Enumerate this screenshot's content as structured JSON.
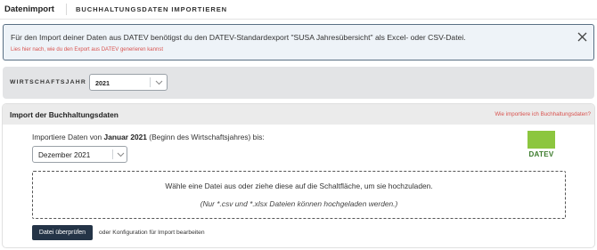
{
  "header": {
    "app_title": "Datenimport",
    "page_title": "BUCHHALTUNGSDATEN IMPORTIEREN"
  },
  "alert": {
    "message": "Für den Import deiner Daten aus DATEV benötigst du den DATEV-Standardexport \"SUSA Jahresübersicht\" als Excel- oder CSV-Datei.",
    "link": "Lies hier nach, wie du den Export aus DATEV generieren kannst",
    "link_color": "#d9534f",
    "close_icon": "close-icon"
  },
  "fiscal_year": {
    "label": "WIRTSCHAFTSJAHR",
    "selected": "2021",
    "icon": "chevron-down-icon"
  },
  "import_card": {
    "title": "Import der Buchhaltungsdaten",
    "help_link": "Wie importiere ich Buchhaltungsdaten?",
    "intro_before": "Importiere Daten von ",
    "intro_bold": "Januar 2021",
    "intro_after": " (Beginn des Wirtschaftsjahres) bis:",
    "end_month": "Dezember 2021",
    "logo_text": "DATEV",
    "logo_color": "#8cc63f",
    "dropzone_main": "Wähle eine Datei aus oder ziehe diese auf die Schaltfläche, um sie hochzuladen.",
    "dropzone_sub": "(Nur *.csv und *.xlsx Dateien können hochgeladen werden.)",
    "check_button": "Datei überprüfen",
    "alt_text": "oder Konfiguration für Import bearbeiten",
    "button_color": "#243447"
  }
}
